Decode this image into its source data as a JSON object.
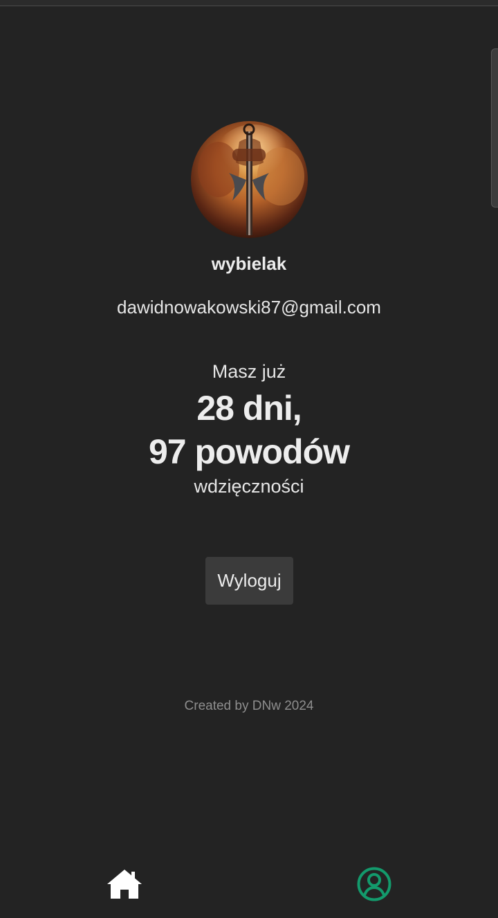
{
  "profile": {
    "username": "wybielak",
    "email": "dawidnowakowski87@gmail.com",
    "avatar_icon": "profile-photo"
  },
  "stats": {
    "intro": "Masz już",
    "days_line": "28 dni,",
    "reasons_line": "97 powodów",
    "outro": "wdzięczności"
  },
  "actions": {
    "logout_label": "Wyloguj"
  },
  "footer": {
    "credit": "Created by DNw 2024"
  },
  "bottom_nav": {
    "items": [
      {
        "icon": "home-icon",
        "active": false
      },
      {
        "icon": "user-circle-icon",
        "active": true
      }
    ]
  },
  "colors": {
    "background": "#232323",
    "text": "#e8e8e8",
    "accent": "#139a6c",
    "button_bg": "#3b3b3b",
    "footer_text": "#8e8e8e"
  }
}
